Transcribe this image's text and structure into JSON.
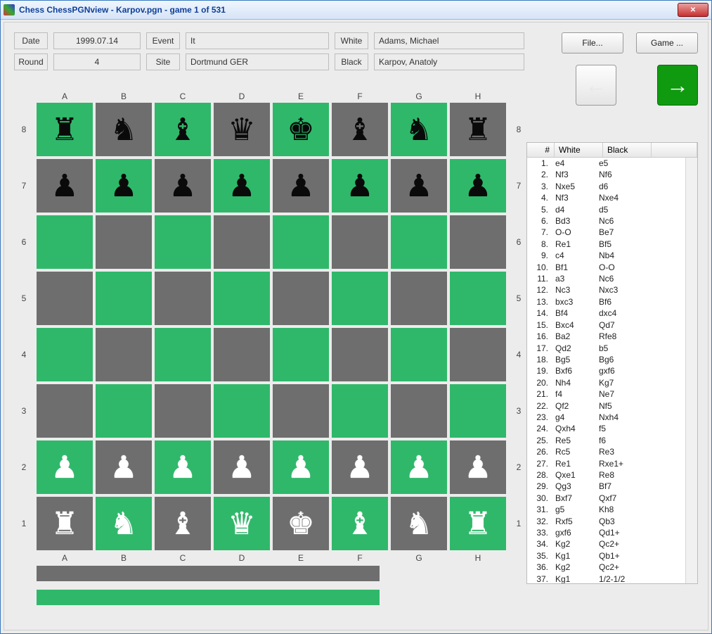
{
  "window": {
    "title": "Chess ChessPGNview - Karpov.pgn - game 1 of 531"
  },
  "info": {
    "date_label": "Date",
    "date_value": "1999.07.14",
    "event_label": "Event",
    "event_value": "It",
    "white_label": "White",
    "white_value": "Adams, Michael",
    "round_label": "Round",
    "round_value": "4",
    "site_label": "Site",
    "site_value": "Dortmund GER",
    "black_label": "Black",
    "black_value": "Karpov, Anatoly"
  },
  "buttons": {
    "file": "File...",
    "game": "Game ..."
  },
  "files": [
    "A",
    "B",
    "C",
    "D",
    "E",
    "F",
    "G",
    "H"
  ],
  "ranks": [
    "8",
    "7",
    "6",
    "5",
    "4",
    "3",
    "2",
    "1"
  ],
  "board": [
    [
      {
        "p": "♜",
        "c": "b"
      },
      {
        "p": "♞",
        "c": "b"
      },
      {
        "p": "♝",
        "c": "b"
      },
      {
        "p": "♛",
        "c": "b"
      },
      {
        "p": "♚",
        "c": "b"
      },
      {
        "p": "♝",
        "c": "b"
      },
      {
        "p": "♞",
        "c": "b"
      },
      {
        "p": "♜",
        "c": "b"
      }
    ],
    [
      {
        "p": "♟",
        "c": "b"
      },
      {
        "p": "♟",
        "c": "b"
      },
      {
        "p": "♟",
        "c": "b"
      },
      {
        "p": "♟",
        "c": "b"
      },
      {
        "p": "♟",
        "c": "b"
      },
      {
        "p": "♟",
        "c": "b"
      },
      {
        "p": "♟",
        "c": "b"
      },
      {
        "p": "♟",
        "c": "b"
      }
    ],
    [
      null,
      null,
      null,
      null,
      null,
      null,
      null,
      null
    ],
    [
      null,
      null,
      null,
      null,
      null,
      null,
      null,
      null
    ],
    [
      null,
      null,
      null,
      null,
      null,
      null,
      null,
      null
    ],
    [
      null,
      null,
      null,
      null,
      null,
      null,
      null,
      null
    ],
    [
      {
        "p": "♙",
        "c": "w"
      },
      {
        "p": "♙",
        "c": "w"
      },
      {
        "p": "♙",
        "c": "w"
      },
      {
        "p": "♙",
        "c": "w"
      },
      {
        "p": "♙",
        "c": "w"
      },
      {
        "p": "♙",
        "c": "w"
      },
      {
        "p": "♙",
        "c": "w"
      },
      {
        "p": "♙",
        "c": "w"
      }
    ],
    [
      {
        "p": "♖",
        "c": "w"
      },
      {
        "p": "♘",
        "c": "w"
      },
      {
        "p": "♗",
        "c": "w"
      },
      {
        "p": "♕",
        "c": "w"
      },
      {
        "p": "♔",
        "c": "w"
      },
      {
        "p": "♗",
        "c": "w"
      },
      {
        "p": "♘",
        "c": "w"
      },
      {
        "p": "♖",
        "c": "w"
      }
    ]
  ],
  "movetable": {
    "headers": {
      "num": "#",
      "white": "White",
      "black": "Black"
    },
    "moves": [
      {
        "n": "1.",
        "w": "e4",
        "b": "e5"
      },
      {
        "n": "2.",
        "w": "Nf3",
        "b": "Nf6"
      },
      {
        "n": "3.",
        "w": "Nxe5",
        "b": "d6"
      },
      {
        "n": "4.",
        "w": "Nf3",
        "b": "Nxe4"
      },
      {
        "n": "5.",
        "w": "d4",
        "b": "d5"
      },
      {
        "n": "6.",
        "w": "Bd3",
        "b": "Nc6"
      },
      {
        "n": "7.",
        "w": "O-O",
        "b": "Be7"
      },
      {
        "n": "8.",
        "w": "Re1",
        "b": "Bf5"
      },
      {
        "n": "9.",
        "w": "c4",
        "b": "Nb4"
      },
      {
        "n": "10.",
        "w": "Bf1",
        "b": "O-O"
      },
      {
        "n": "11.",
        "w": "a3",
        "b": "Nc6"
      },
      {
        "n": "12.",
        "w": "Nc3",
        "b": "Nxc3"
      },
      {
        "n": "13.",
        "w": "bxc3",
        "b": "Bf6"
      },
      {
        "n": "14.",
        "w": "Bf4",
        "b": "dxc4"
      },
      {
        "n": "15.",
        "w": "Bxc4",
        "b": "Qd7"
      },
      {
        "n": "16.",
        "w": "Ba2",
        "b": "Rfe8"
      },
      {
        "n": "17.",
        "w": "Qd2",
        "b": "b5"
      },
      {
        "n": "18.",
        "w": "Bg5",
        "b": "Bg6"
      },
      {
        "n": "19.",
        "w": "Bxf6",
        "b": "gxf6"
      },
      {
        "n": "20.",
        "w": "Nh4",
        "b": "Kg7"
      },
      {
        "n": "21.",
        "w": "f4",
        "b": "Ne7"
      },
      {
        "n": "22.",
        "w": "Qf2",
        "b": "Nf5"
      },
      {
        "n": "23.",
        "w": "g4",
        "b": "Nxh4"
      },
      {
        "n": "24.",
        "w": "Qxh4",
        "b": "f5"
      },
      {
        "n": "25.",
        "w": "Re5",
        "b": "f6"
      },
      {
        "n": "26.",
        "w": "Rc5",
        "b": "Re3"
      },
      {
        "n": "27.",
        "w": "Re1",
        "b": "Rxe1+"
      },
      {
        "n": "28.",
        "w": "Qxe1",
        "b": "Re8"
      },
      {
        "n": "29.",
        "w": "Qg3",
        "b": "Bf7"
      },
      {
        "n": "30.",
        "w": "Bxf7",
        "b": "Qxf7"
      },
      {
        "n": "31.",
        "w": "g5",
        "b": "Kh8"
      },
      {
        "n": "32.",
        "w": "Rxf5",
        "b": "Qb3"
      },
      {
        "n": "33.",
        "w": "gxf6",
        "b": "Qd1+"
      },
      {
        "n": "34.",
        "w": "Kg2",
        "b": "Qc2+"
      },
      {
        "n": "35.",
        "w": "Kg1",
        "b": "Qb1+"
      },
      {
        "n": "36.",
        "w": "Kg2",
        "b": "Qc2+"
      },
      {
        "n": "37.",
        "w": "Kg1",
        "b": "1/2-1/2"
      }
    ]
  }
}
